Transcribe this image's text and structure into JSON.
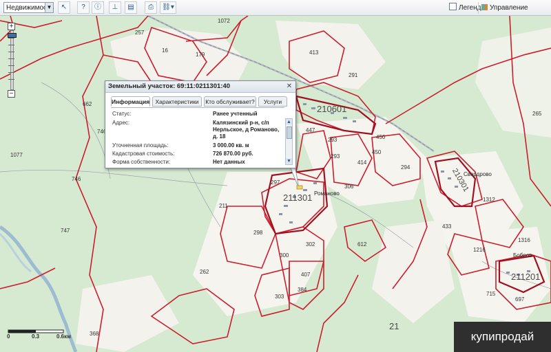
{
  "toolbar": {
    "layer_select": "Недвижимость",
    "legend_label": "Легенда",
    "map_control_label": "Управление картой",
    "tool_icons": [
      "select-arrow-icon",
      "identify-icon",
      "info-icon",
      "ruler-icon",
      "layers-icon",
      "print-icon",
      "link-icon"
    ]
  },
  "popup": {
    "title": "Земельный участок: 69:11:0211301:40",
    "tabs": [
      "Информация",
      "Характеристики",
      "Кто обслуживает?",
      "Услуги"
    ],
    "active_tab": "Информация",
    "rows": [
      {
        "key": "Статус:",
        "value": "Ранее учтенный"
      },
      {
        "key": "Адрес:",
        "value": "Калязинский р-н, с/п Нерльское, д Романово, д. 18"
      },
      {
        "key": "Уточненная площадь:",
        "value": "3 000.00 кв. м"
      },
      {
        "key": "Кадастровая стоимость:",
        "value": "726 870.00 руб."
      },
      {
        "key": "Форма собственности:",
        "value": "Нет данных"
      }
    ]
  },
  "map": {
    "parcel_numbers": [
      "1072",
      "16",
      "179",
      "413",
      "291",
      "257",
      "662",
      "746",
      "1077",
      "746",
      "747",
      "211",
      "298",
      "297",
      "293",
      "293",
      "450",
      "450",
      "414",
      "306",
      "294",
      "302",
      "300",
      "262",
      "407",
      "384",
      "303",
      "612",
      "1312",
      "433",
      "1216",
      "1316",
      "21",
      "368",
      "715",
      "697",
      "265",
      "1201",
      "447"
    ],
    "quarter_labels": [
      "210601",
      "211301",
      "210301",
      "211201"
    ],
    "village_labels": [
      "Романово",
      "Свердрово",
      "Бобров"
    ],
    "big_label": "21"
  },
  "scale": {
    "labels": [
      "0",
      "0.3",
      "0.6км"
    ]
  },
  "watermark": "купипродай",
  "colors": {
    "boundary": "#cc1d2b",
    "forest": "#d7ead2",
    "field": "#f5f3ee",
    "water": "#a6c4d8",
    "road": "#d42a2a"
  }
}
